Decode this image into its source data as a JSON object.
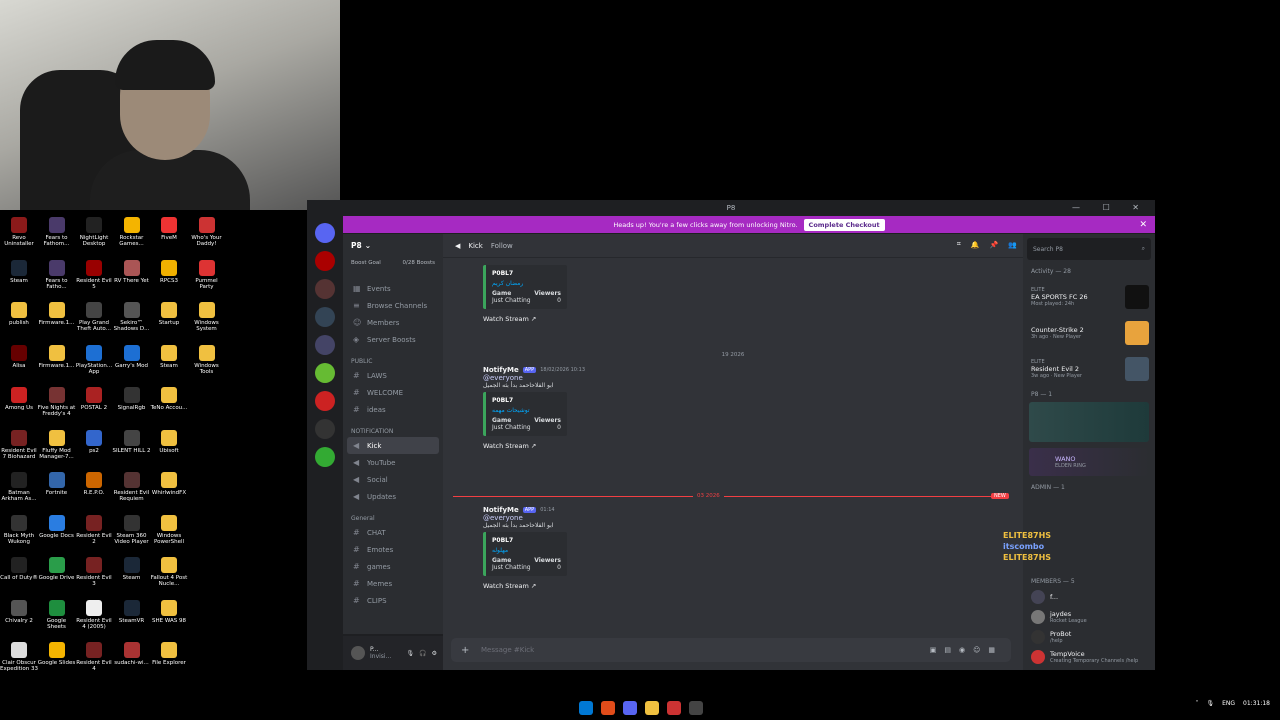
{
  "webcam": {
    "label": "webcam overlay"
  },
  "desktop_icons": [
    {
      "label": "Revo Uninstaller",
      "c": "#8b1a1a"
    },
    {
      "label": "Fears to Fathom...",
      "c": "#4a3a6a"
    },
    {
      "label": "NightLight Desktop",
      "c": "#222"
    },
    {
      "label": "Rockstar Games...",
      "c": "#f4b400"
    },
    {
      "label": "FiveM",
      "c": "#e33"
    },
    {
      "label": "Who's Your Daddy!",
      "c": "#c33"
    },
    {
      "label": "Steam",
      "c": "#1b2838"
    },
    {
      "label": "Fears to Fatho...",
      "c": "#4a3a6a"
    },
    {
      "label": "Resident Evil 5",
      "c": "#900"
    },
    {
      "label": "RV There Yet",
      "c": "#a55"
    },
    {
      "label": "RPCS3",
      "c": "#f0b000"
    },
    {
      "label": "Pummel Party",
      "c": "#d33"
    },
    {
      "label": "publish",
      "c": "#f0c040"
    },
    {
      "label": "Firmware.1...",
      "c": "#f0c040"
    },
    {
      "label": "Play Grand Theft Auto...",
      "c": "#444"
    },
    {
      "label": "Sekiro™ Shadows D...",
      "c": "#555"
    },
    {
      "label": "Startup",
      "c": "#f0c040"
    },
    {
      "label": "Windows System",
      "c": "#f0c040"
    },
    {
      "label": "Alisa",
      "c": "#600"
    },
    {
      "label": "Firmware.1...",
      "c": "#f0c040"
    },
    {
      "label": "PlayStation... App",
      "c": "#1d6fd3"
    },
    {
      "label": "Garry's Mod",
      "c": "#1d6fd3"
    },
    {
      "label": "Steam",
      "c": "#f0c040"
    },
    {
      "label": "Windows Tools",
      "c": "#f0c040"
    },
    {
      "label": "Among Us",
      "c": "#c22"
    },
    {
      "label": "Five Nights at Freddy's 4",
      "c": "#733"
    },
    {
      "label": "POSTAL 2",
      "c": "#a22"
    },
    {
      "label": "SignalRgb",
      "c": "#333"
    },
    {
      "label": "TeNo Accou...",
      "c": "#f0c040"
    },
    {
      "label": "",
      "c": "#000"
    },
    {
      "label": "Resident Evil 7 Biohazard",
      "c": "#722"
    },
    {
      "label": "Fluffy Mod Manager-7...",
      "c": "#f0c040"
    },
    {
      "label": "ps2",
      "c": "#36c"
    },
    {
      "label": "SILENT HILL 2",
      "c": "#444"
    },
    {
      "label": "Ubisoft",
      "c": "#f0c040"
    },
    {
      "label": "",
      "c": "#000"
    },
    {
      "label": "Batman Arkham As...",
      "c": "#222"
    },
    {
      "label": "Fortnite",
      "c": "#36a"
    },
    {
      "label": "R.E.P.O.",
      "c": "#c60"
    },
    {
      "label": "Resident Evil Requiem",
      "c": "#533"
    },
    {
      "label": "WhirlwindFX",
      "c": "#f0c040"
    },
    {
      "label": "",
      "c": "#000"
    },
    {
      "label": "Black Myth Wukong",
      "c": "#333"
    },
    {
      "label": "Google Docs",
      "c": "#2a7de1"
    },
    {
      "label": "Resident Evil 2",
      "c": "#722"
    },
    {
      "label": "Steam 360 Video Player",
      "c": "#333"
    },
    {
      "label": "Windows PowerShell",
      "c": "#f0c040"
    },
    {
      "label": "",
      "c": "#000"
    },
    {
      "label": "Call of Duty®",
      "c": "#222"
    },
    {
      "label": "Google Drive",
      "c": "#2a9d4a"
    },
    {
      "label": "Resident Evil 3",
      "c": "#722"
    },
    {
      "label": "Steam",
      "c": "#1b2838"
    },
    {
      "label": "Fallout 4 Post Nucle...",
      "c": "#f0c040"
    },
    {
      "label": "",
      "c": "#000"
    },
    {
      "label": "Chivalry 2",
      "c": "#555"
    },
    {
      "label": "Google Sheets",
      "c": "#1e8e3e"
    },
    {
      "label": "Resident Evil 4 (2005)",
      "c": "#eee"
    },
    {
      "label": "SteamVR",
      "c": "#1b2838"
    },
    {
      "label": "SHE WAS 98",
      "c": "#f0c040"
    },
    {
      "label": "",
      "c": "#000"
    },
    {
      "label": "Clair Obscur Expedition 33",
      "c": "#ddd"
    },
    {
      "label": "Google Slides",
      "c": "#f4b400"
    },
    {
      "label": "Resident Evil 4",
      "c": "#722"
    },
    {
      "label": "sudachi-wi...",
      "c": "#a33"
    },
    {
      "label": "File Explorer",
      "c": "#f0c040"
    },
    {
      "label": "",
      "c": "#000"
    }
  ],
  "window": {
    "title": "P8"
  },
  "nitro": {
    "text": "Heads up! You're a few clicks away from unlocking Nitro.",
    "button": "Complete Checkout"
  },
  "server": {
    "name": "P8",
    "boost_goal": "Boost Goal",
    "boosts": "0/28 Boosts"
  },
  "menu": [
    "Events",
    "Browse Channels",
    "Members",
    "Server Boosts"
  ],
  "categories": {
    "public": "PUBLIC",
    "notification": "NOTIFICATION",
    "general": "General"
  },
  "channels_public": [
    "LAWS",
    "WELCOME",
    "ideas"
  ],
  "channels_notification": [
    "Kick",
    "YouTube",
    "Social",
    "Updates"
  ],
  "channels_general": [
    "CHAT",
    "Emotes",
    "games",
    "Memes",
    "CLIPS"
  ],
  "user": {
    "name": "P...",
    "status": "Invisi..."
  },
  "chat": {
    "channel_name": "Kick",
    "follow": "Follow",
    "search_placeholder": "Search P8",
    "message_placeholder": "Message #Kick",
    "msgs": [
      {
        "author": "",
        "app": "",
        "time": "",
        "mention": "",
        "body": "",
        "embed_title": "P0BL7",
        "embed_sub": "رمضان كريم",
        "game": "Game",
        "game_val": "Just Chatting",
        "viewers": "Viewers",
        "viewers_val": "0",
        "watch": "Watch Stream"
      },
      {
        "author": "NotifyMe",
        "app": "APP",
        "time": "18/02/2026 10:13",
        "mention": "@everyone",
        "body": "ابو الفلاحاحمد بدأ بثه الجميل",
        "embed_title": "P0BL7",
        "embed_sub": "توشيحات مهمه",
        "game": "Game",
        "game_val": "Just Chatting",
        "viewers": "Viewers",
        "viewers_val": "0",
        "watch": "Watch Stream"
      },
      {
        "author": "NotifyMe",
        "app": "APP",
        "time": "01:14",
        "mention": "@everyone",
        "body": "ابو الفلاحاحمد بدأ بثه الجميل",
        "embed_title": "P0BL7",
        "embed_sub": "مهلوله",
        "game": "Game",
        "game_val": "Just Chatting",
        "viewers": "Viewers",
        "viewers_val": "0",
        "watch": "Watch Stream"
      }
    ],
    "divider1": "19 2026",
    "divider2": "03 2026",
    "new_badge": "NEW"
  },
  "activity": {
    "header": "Activity — 28",
    "items": [
      {
        "tag": "ELITE",
        "name": "EA SPORTS FC 26",
        "sub": "Most played: 24h",
        "c": "#111"
      },
      {
        "tag": "",
        "name": "Counter-Strike 2",
        "sub": "3h ago · New Player",
        "c": "#e8a33d"
      },
      {
        "tag": "ELITE",
        "name": "Resident Evil 2",
        "sub": "3w ago · New Player",
        "c": "#456"
      }
    ]
  },
  "members": {
    "p8_header": "P8 — 1",
    "admin_header": "ADMIN — 1",
    "members_header": "MEMBERS — 5",
    "list": [
      {
        "name": "WANO",
        "sub": "ELDEN RING",
        "c": "#6a4"
      },
      {
        "name": "f...",
        "sub": "",
        "c": "#445"
      },
      {
        "name": "jaydes",
        "sub": "Rocket League",
        "c": "#777"
      },
      {
        "name": "ProBot",
        "sub": "/help",
        "c": "#333"
      },
      {
        "name": "TempVoice",
        "sub": "Creating Temporary Channels /help",
        "c": "#c33"
      }
    ],
    "overlay": [
      "ELITE87HS",
      "itscombo",
      "ELITE87HS"
    ]
  },
  "tray": {
    "lang": "ENG",
    "time": "01:31:18"
  }
}
